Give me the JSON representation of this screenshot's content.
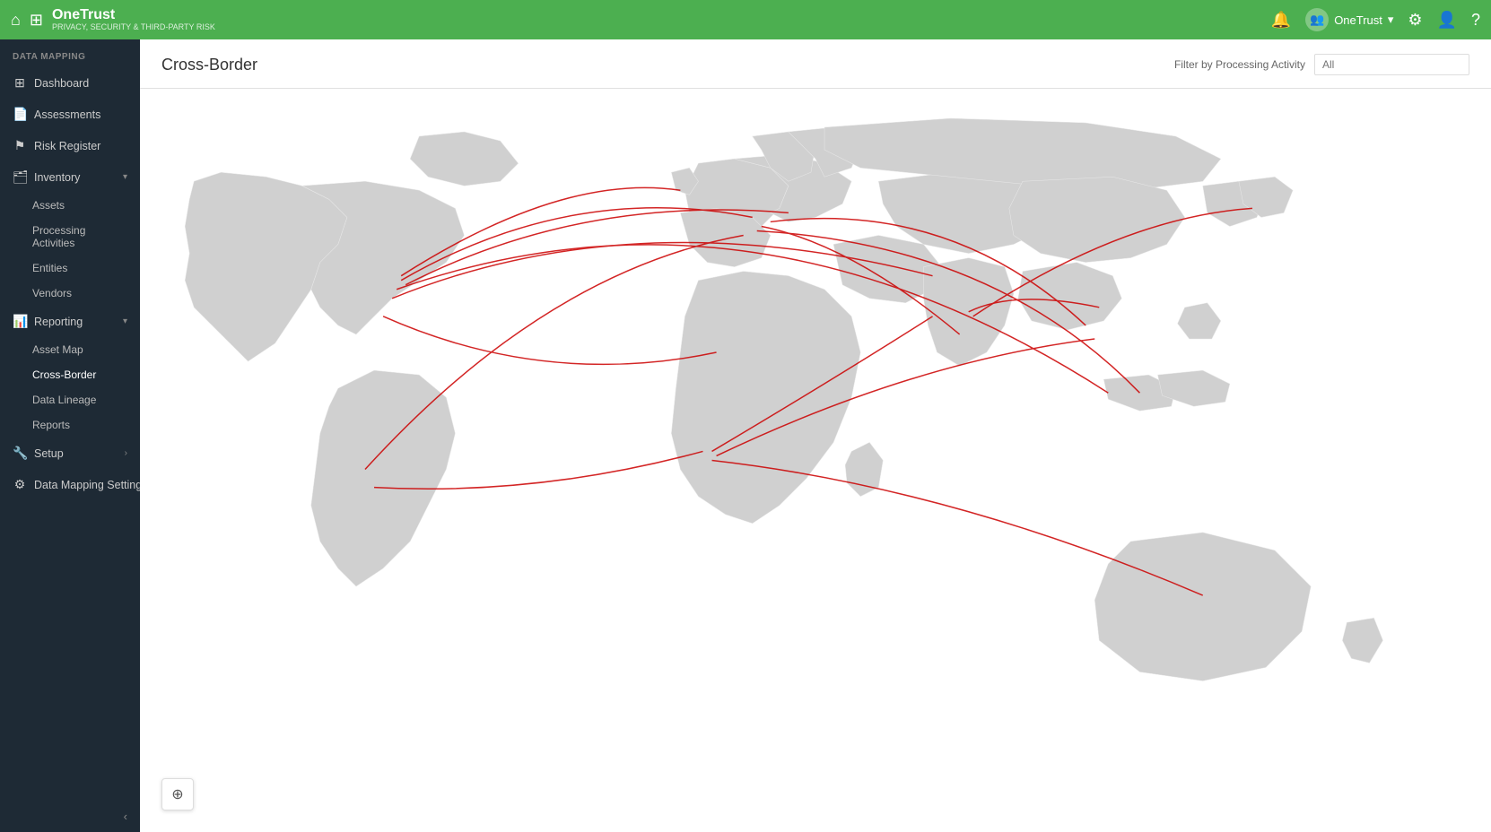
{
  "topnav": {
    "brand_name": "OneTrust",
    "brand_tagline": "PRIVACY, SECURITY & THIRD-PARTY RISK",
    "user_label": "OneTrust"
  },
  "sidebar": {
    "section_label": "DATA MAPPING",
    "items": [
      {
        "id": "dashboard",
        "label": "Dashboard",
        "icon": "⊞",
        "has_children": false
      },
      {
        "id": "assessments",
        "label": "Assessments",
        "icon": "📋",
        "has_children": false
      },
      {
        "id": "risk-register",
        "label": "Risk Register",
        "icon": "⚑",
        "has_children": false
      },
      {
        "id": "inventory",
        "label": "Inventory",
        "icon": "🗂",
        "has_children": true,
        "expanded": true
      },
      {
        "id": "assets",
        "label": "Assets",
        "sub": true
      },
      {
        "id": "processing-activities",
        "label": "Processing Activities",
        "sub": true
      },
      {
        "id": "entities",
        "label": "Entities",
        "sub": true
      },
      {
        "id": "vendors",
        "label": "Vendors",
        "sub": true
      },
      {
        "id": "reporting",
        "label": "Reporting",
        "icon": "📊",
        "has_children": true,
        "expanded": true
      },
      {
        "id": "asset-map",
        "label": "Asset Map",
        "sub": true
      },
      {
        "id": "cross-border",
        "label": "Cross-Border",
        "sub": true,
        "active": true
      },
      {
        "id": "data-lineage",
        "label": "Data Lineage",
        "sub": true
      },
      {
        "id": "reports",
        "label": "Reports",
        "sub": true
      },
      {
        "id": "setup",
        "label": "Setup",
        "icon": "🔧",
        "has_children": true
      },
      {
        "id": "data-mapping-settings",
        "label": "Data Mapping Settings",
        "icon": "⚙",
        "has_children": false
      }
    ]
  },
  "content": {
    "page_title": "Cross-Border",
    "filter_label": "Filter by Processing Activity",
    "filter_placeholder": "All"
  },
  "layers_btn_title": "Layers"
}
